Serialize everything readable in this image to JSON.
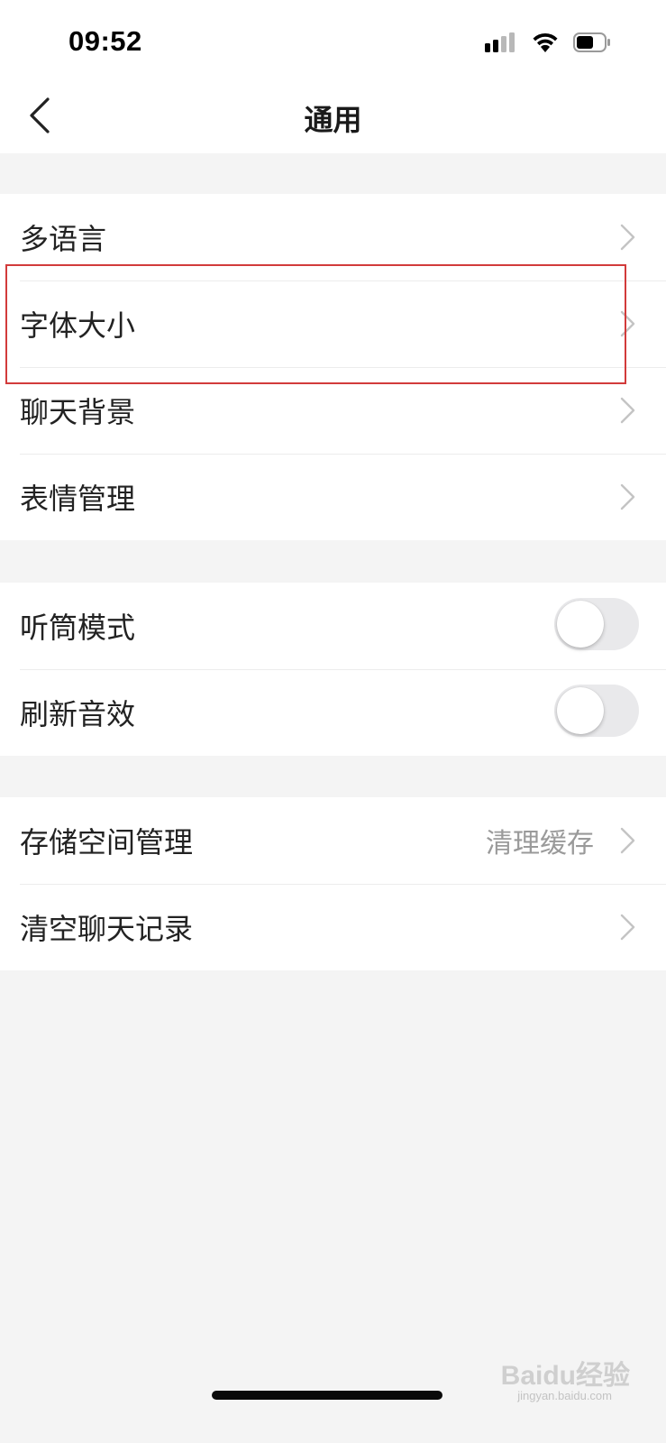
{
  "status_bar": {
    "time": "09:52"
  },
  "nav": {
    "title": "通用"
  },
  "groups": [
    {
      "items": [
        {
          "label": "多语言",
          "type": "link"
        },
        {
          "label": "字体大小",
          "type": "link",
          "highlighted": true
        },
        {
          "label": "聊天背景",
          "type": "link"
        },
        {
          "label": "表情管理",
          "type": "link"
        }
      ]
    },
    {
      "items": [
        {
          "label": "听筒模式",
          "type": "toggle",
          "on": false
        },
        {
          "label": "刷新音效",
          "type": "toggle",
          "on": false
        }
      ]
    },
    {
      "items": [
        {
          "label": "存储空间管理",
          "type": "link",
          "value": "清理缓存"
        },
        {
          "label": "清空聊天记录",
          "type": "link"
        }
      ]
    }
  ],
  "colors": {
    "background": "#f4f4f4",
    "highlight": "#d23b3b",
    "toggle_off": "#e9e9eb"
  },
  "watermark": {
    "brand": "Baidu经验",
    "url": "jingyan.baidu.com"
  }
}
